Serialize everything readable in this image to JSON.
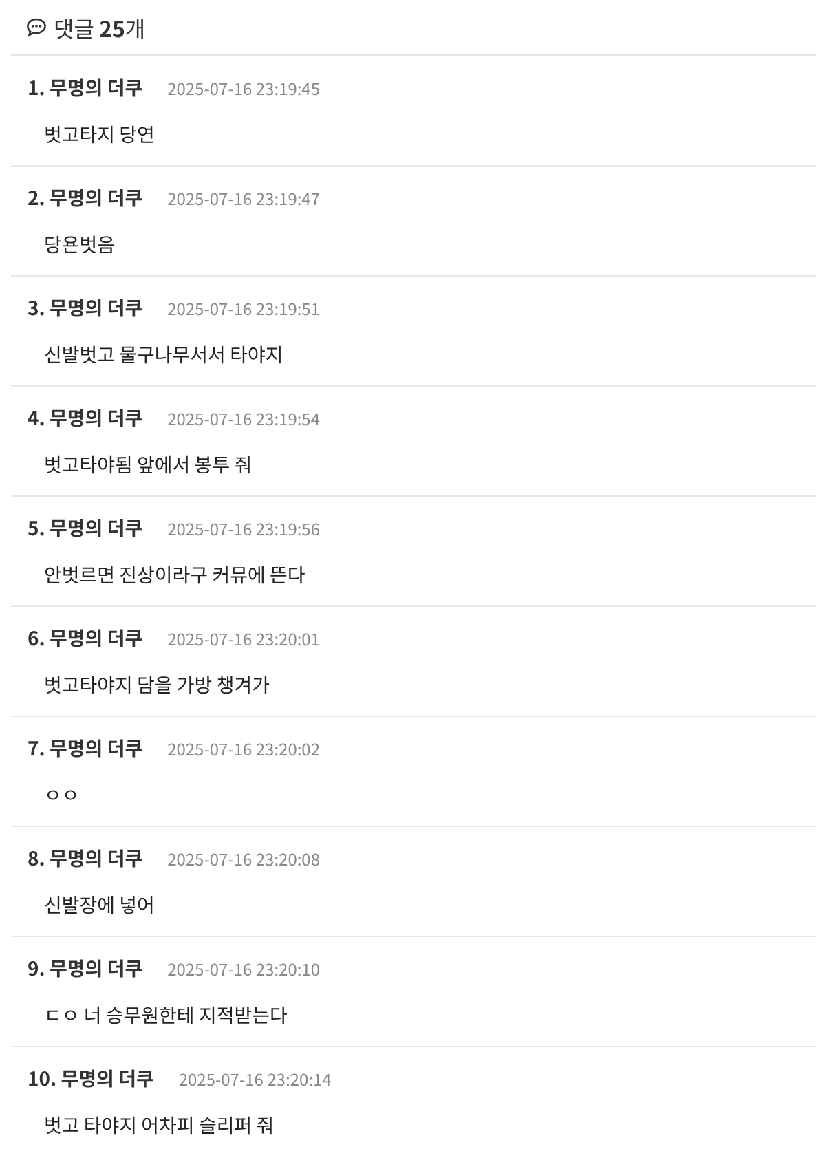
{
  "header": {
    "title": "댓글 **25**개"
  },
  "comments": [
    {
      "number": "1.",
      "author": "무명의 더쿠",
      "time": "2025-07-16 23:19:45",
      "text": "벗고타지 당연"
    },
    {
      "number": "2.",
      "author": "무명의 더쿠",
      "time": "2025-07-16 23:19:47",
      "text": "당욘벗음"
    },
    {
      "number": "3.",
      "author": "무명의 더쿠",
      "time": "2025-07-16 23:19:51",
      "text": "신발벗고 물구나무서서 타야지"
    },
    {
      "number": "4.",
      "author": "무명의 더쿠",
      "time": "2025-07-16 23:19:54",
      "text": "벗고타야됨 앞에서 봉투 줘"
    },
    {
      "number": "5.",
      "author": "무명의 더쿠",
      "time": "2025-07-16 23:19:56",
      "text": "안벗르면 진상이라구 커뮤에 뜬다"
    },
    {
      "number": "6.",
      "author": "무명의 더쿠",
      "time": "2025-07-16 23:20:01",
      "text": "벗고타야지 담을 가방 챙겨가"
    },
    {
      "number": "7.",
      "author": "무명의 더쿠",
      "time": "2025-07-16 23:20:02",
      "text": "ㅇㅇ"
    },
    {
      "number": "8.",
      "author": "무명의 더쿠",
      "time": "2025-07-16 23:20:08",
      "text": "신발장에 넣어"
    },
    {
      "number": "9.",
      "author": "무명의 더쿠",
      "time": "2025-07-16 23:20:10",
      "text": "ㄷㅇ 너 승무원한테 지적받는다"
    },
    {
      "number": "10.",
      "author": "무명의 더쿠",
      "time": "2025-07-16 23:20:14",
      "text": "벗고 타야지 어차피 슬리퍼 줘"
    }
  ]
}
